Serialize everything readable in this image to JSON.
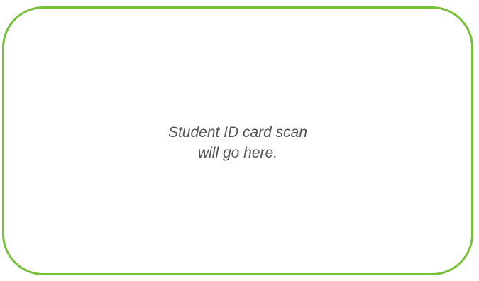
{
  "card": {
    "placeholder_lines": [
      "Student ID card scan",
      "will go here."
    ]
  },
  "colors": {
    "border": "#77c03a",
    "text": "#555555",
    "background": "#ffffff"
  }
}
